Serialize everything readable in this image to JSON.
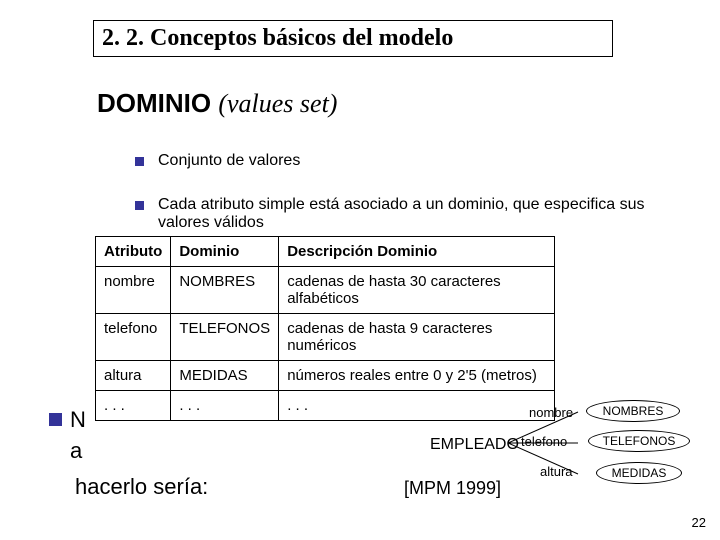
{
  "heading": "2. 2. Conceptos básicos del modelo",
  "title": {
    "main": "DOMINIO",
    "paren": "(values set)"
  },
  "bullets": {
    "b1": "Conjunto de valores",
    "b2": "Cada atributo simple está asociado a un dominio, que especifica sus valores válidos"
  },
  "table": {
    "headers": {
      "c1": "Atributo",
      "c2": "Dominio",
      "c3": "Descripción Dominio"
    },
    "rows": [
      {
        "c1": "nombre",
        "c2": "NOMBRES",
        "c3": "cadenas de hasta 30 caracteres alfabéticos"
      },
      {
        "c1": "telefono",
        "c2": "TELEFONOS",
        "c3": "cadenas de hasta 9 caracteres numéricos"
      },
      {
        "c1": "altura",
        "c2": "MEDIDAS",
        "c3": "números reales entre 0 y 2'5 (metros)"
      },
      {
        "c1": ". . .",
        "c2": ". . .",
        "c3": ". . ."
      }
    ]
  },
  "fragments": {
    "f1": "N",
    "f2": "a",
    "f3": "hacerlo sería:"
  },
  "diagram": {
    "entity": "EMPLEADO",
    "attrs": {
      "nombre": "nombre",
      "telefono": "telefono",
      "altura": "altura"
    },
    "ovals": {
      "nombres": "NOMBRES",
      "telefonos": "TELEFONOS",
      "medidas": "MEDIDAS"
    }
  },
  "citation": "[MPM 1999]",
  "page": "22"
}
